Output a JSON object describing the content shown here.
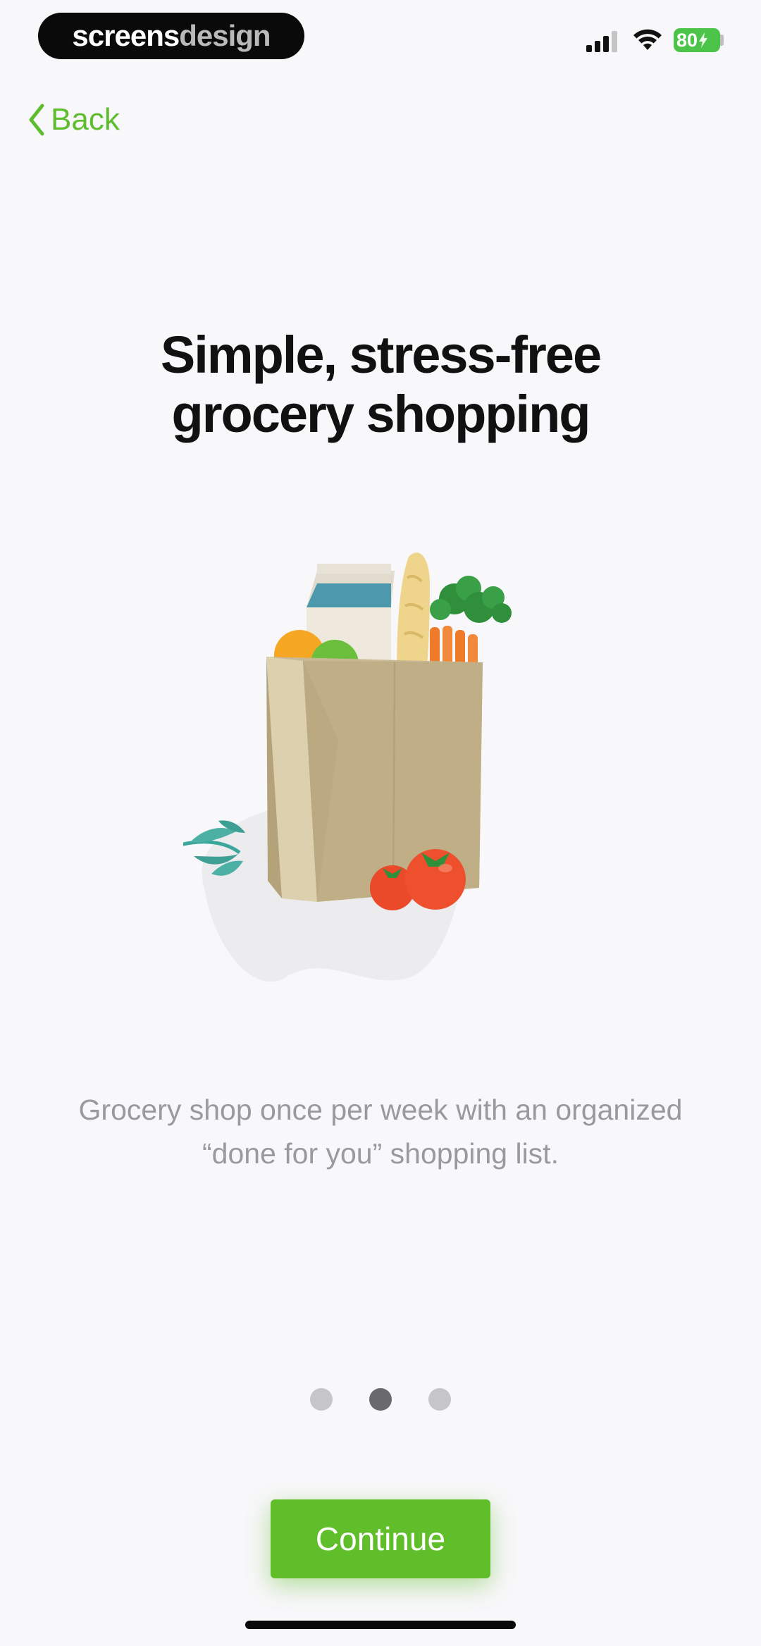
{
  "status_bar": {
    "brand_part1": "screens",
    "brand_part2": "design",
    "battery_level": "80",
    "signal_icon": "cellular-signal-icon",
    "wifi_icon": "wifi-icon",
    "battery_color": "#4cc44a"
  },
  "nav": {
    "back_label": "Back",
    "back_icon": "chevron-left-icon"
  },
  "onboarding": {
    "title_line1": "Simple, stress-free",
    "title_line2": "grocery shopping",
    "subtitle": "Grocery shop once per week with an organized “done for you” shopping list.",
    "illustration": "grocery-bag-illustration",
    "pagination": {
      "total": 3,
      "active_index": 1
    },
    "continue_label": "Continue"
  },
  "colors": {
    "accent": "#5fbe2a",
    "background": "#f8f7fa",
    "title": "#111111",
    "subtitle": "#9a9a9e"
  }
}
